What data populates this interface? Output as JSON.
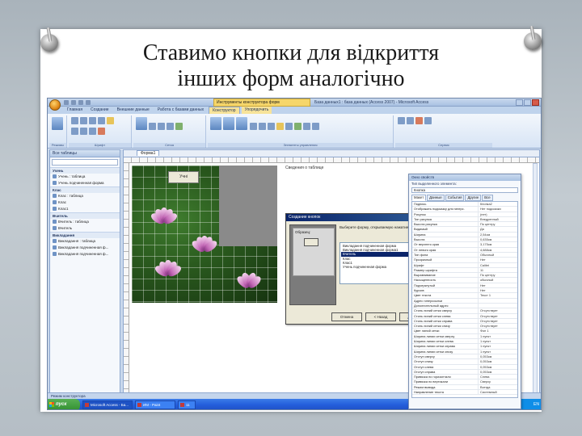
{
  "slide": {
    "title_line1": "Ставимо кнопки для відкриття",
    "title_line2": "інших форм аналогічно"
  },
  "app": {
    "context_tab": "Инструменты конструктора форм",
    "window_title": "База данных1 : база данных (Access 2007) - Microsoft Access"
  },
  "ribbon": {
    "tabs": [
      "Главная",
      "Создание",
      "Внешние данные",
      "Работа с базами данных",
      "Конструктор",
      "Упорядочить"
    ],
    "groups": [
      "Режимы",
      "Шрифт",
      "Сетка",
      "Элементы управления",
      "Сервис"
    ]
  },
  "nav": {
    "header": "Все таблицы",
    "sections": [
      {
        "name": "Учень",
        "items": [
          "Учень : таблица",
          "Учень подчиненная форма"
        ]
      },
      {
        "name": "Клас",
        "items": [
          "Клас : таблица",
          "Клас",
          "Клас1"
        ]
      },
      {
        "name": "Вчитель",
        "items": [
          "Вчитель : таблица",
          "Вчитель"
        ]
      },
      {
        "name": "Викладання",
        "items": [
          "Викладання : таблица",
          "Викладання подчиненная ф...",
          "Викладання подчиненная ф..."
        ]
      }
    ]
  },
  "document": {
    "tab": "Форма1",
    "design_button": "Учні",
    "panel_header": "Сведения о таблице"
  },
  "wizard": {
    "title": "Создание кнопок",
    "left_label": "Образец:",
    "prompt": "Выберите форму, открываемую нажатием кнопки.",
    "list": [
      "Викладання подчиненная форма",
      "Викладання подчиненная форма1",
      "Вчитель",
      "Клас",
      "Клас1",
      "Учень подчиненная форма"
    ],
    "selected_index": 2,
    "buttons": [
      "Отмена",
      "< Назад",
      "Далее >",
      "Готово"
    ]
  },
  "props": {
    "title": "Окно свойств",
    "sub": "Тип выделенного элемента:",
    "selected": "Кнопка",
    "tabs": [
      "Макет",
      "Данные",
      "События",
      "Другие",
      "Все"
    ],
    "rows": [
      [
        "Подпись",
        "Кнопка2"
      ],
      [
        "Отображать подсказку для гиперс.",
        "Нет подсказки"
      ],
      [
        "Рисунок",
        "(нет)"
      ],
      [
        "Тип рисунка",
        "Внедренный"
      ],
      [
        "Высота рисунка",
        "По центру"
      ],
      [
        "Видимый",
        "Да"
      ],
      [
        "Ширина",
        "2,54см"
      ],
      [
        "Высота",
        "0,635см"
      ],
      [
        "От верхнего края",
        "3,175см"
      ],
      [
        "От левого края",
        "4,688см"
      ],
      [
        "Тип фона",
        "Обычный"
      ],
      [
        "Прозрачный",
        "Нет"
      ],
      [
        "Шрифт",
        "Calibri"
      ],
      [
        "Размер шрифта",
        "11"
      ],
      [
        "Выравнивание",
        "По центру"
      ],
      [
        "Насыщенность",
        "обычный"
      ],
      [
        "Подчеркнутый",
        "Нет"
      ],
      [
        "Курсив",
        "Нет"
      ],
      [
        "Цвет текста",
        "Текст 1"
      ],
      [
        "Адрес гиперссылки",
        ""
      ],
      [
        "Дополнительный адрес",
        ""
      ],
      [
        "Стиль линий сетки сверху",
        "Отсутствует"
      ],
      [
        "Стиль линий сетки слева",
        "Отсутствует"
      ],
      [
        "Стиль линий сетки справа",
        "Отсутствует"
      ],
      [
        "Стиль линий сетки снизу",
        "Отсутствует"
      ],
      [
        "Цвет линий сетки",
        "Фон 1"
      ],
      [
        "Ширина линии сетки сверху",
        "1 пункт"
      ],
      [
        "Ширина линии сетки слева",
        "1 пункт"
      ],
      [
        "Ширина линии сетки справа",
        "1 пункт"
      ],
      [
        "Ширина линии сетки снизу",
        "1 пункт"
      ],
      [
        "Отступ сверху",
        "0,053см"
      ],
      [
        "Отступ снизу",
        "0,053см"
      ],
      [
        "Отступ слева",
        "0,053см"
      ],
      [
        "Отступ справа",
        "0,053см"
      ],
      [
        "Привязка по горизонтали",
        "Слева"
      ],
      [
        "Привязка по вертикали",
        "Сверху"
      ],
      [
        "Режим вывода",
        "Всегда"
      ],
      [
        "Направление текста",
        "Системный"
      ]
    ]
  },
  "status": {
    "left": "Режим конструктора",
    "right": "NumLock"
  },
  "taskbar": {
    "start": "пуск",
    "items": [
      "Microsoft Access - Ба...",
      "ИМ - Paint",
      "11"
    ],
    "lang": "EN"
  }
}
